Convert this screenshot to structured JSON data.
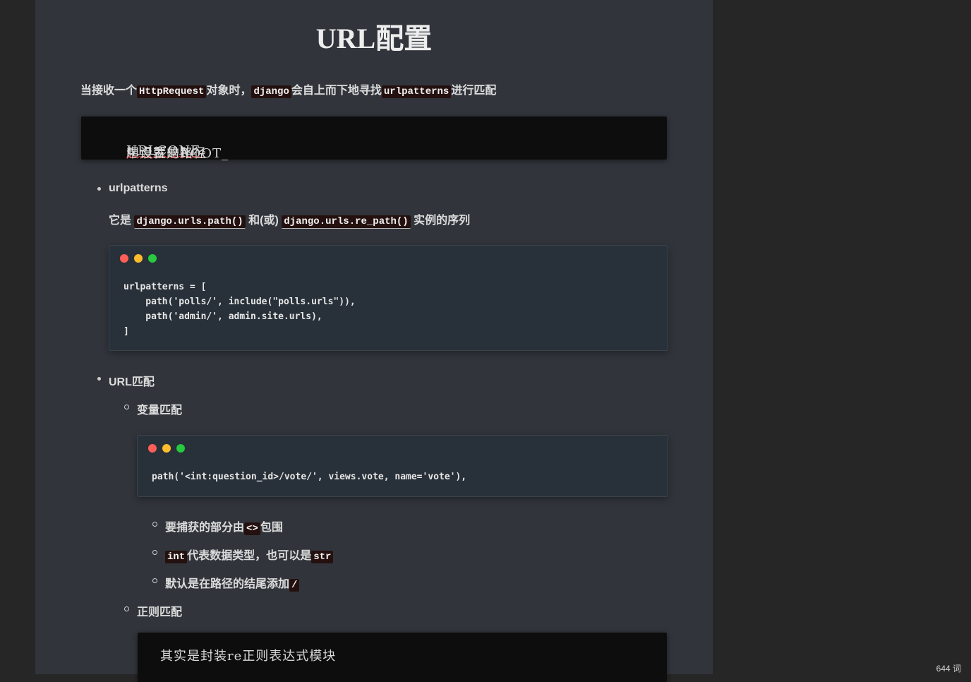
{
  "doc": {
    "title": "URL配置",
    "intro": {
      "t1": "当接收一个",
      "c1": "HttpRequest",
      "t2": "对象时，",
      "c2": "django",
      "t3": "会自上而下地寻找",
      "c3": "urlpatterns",
      "t4": "进行匹配"
    },
    "quote1": {
      "pre": "起点就是ROOT_",
      "squiggle": "URLCONF",
      "post": "中设置的路径"
    },
    "bullet1": "urlpatterns",
    "desc": {
      "t1": "它是",
      "c1": "django.urls.path()",
      "t2": "和(或)",
      "c2": "django.urls.re_path()",
      "t3": "实例的序列"
    },
    "code1": "urlpatterns = [\n    path('polls/', include(\"polls.urls\")),\n    path('admin/', admin.site.urls),\n]",
    "bullet2": "URL匹配",
    "sub1": "变量匹配",
    "code2": "path('<int:question_id>/vote/', views.vote, name='vote'),",
    "items": {
      "i1_t": "要捕获的部分由",
      "i1_c": "<>",
      "i1_t2": "包围",
      "i2_c": "int",
      "i2_t": "代表数据类型，也可以是",
      "i2_c2": "str",
      "i3_t": "默认是在路径的结尾添加",
      "i3_c": "/"
    },
    "sub2": "正则匹配",
    "quote2": "其实是封装re正则表达式模块"
  },
  "status": {
    "word_count": "644 词"
  },
  "colors": {
    "dot_red": "#ff5f56",
    "dot_yellow": "#ffbd2e",
    "dot_green": "#27c93f"
  }
}
